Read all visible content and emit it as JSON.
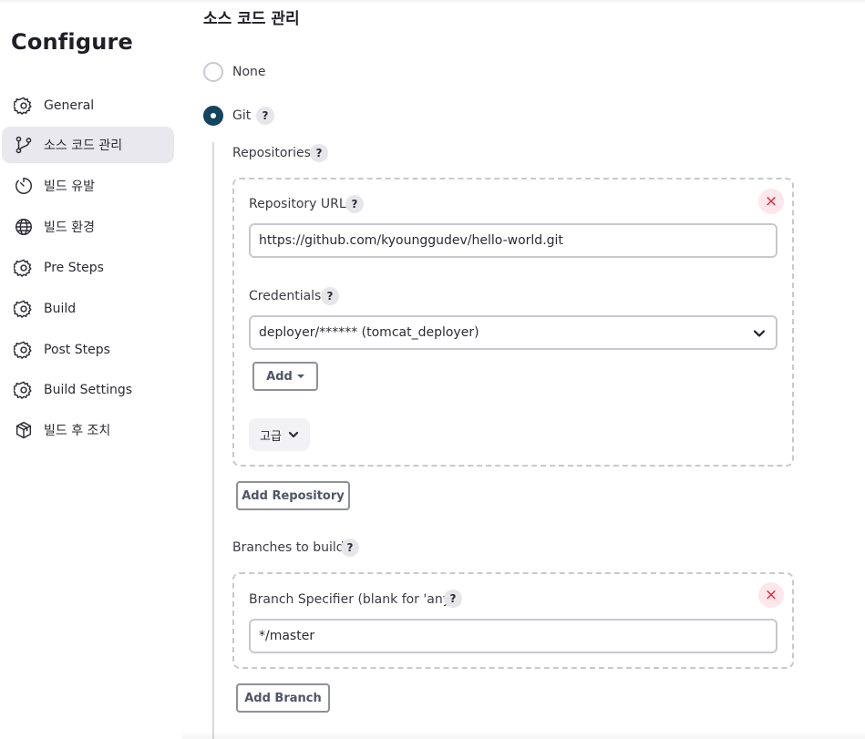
{
  "sidebar": {
    "title": "Configure",
    "items": [
      {
        "label": "General",
        "icon": "gear-icon"
      },
      {
        "label": "소스 코드 관리",
        "icon": "branch-icon",
        "active": true
      },
      {
        "label": "빌드 유발",
        "icon": "timer-icon"
      },
      {
        "label": "빌드 환경",
        "icon": "globe-icon"
      },
      {
        "label": "Pre Steps",
        "icon": "gear-icon"
      },
      {
        "label": "Build",
        "icon": "gear-icon"
      },
      {
        "label": "Post Steps",
        "icon": "gear-icon"
      },
      {
        "label": "Build Settings",
        "icon": "gear-icon"
      },
      {
        "label": "빌드 후 조치",
        "icon": "package-icon"
      }
    ]
  },
  "main": {
    "section_title": "소스 코드 관리",
    "scm_options": [
      {
        "label": "None",
        "selected": false
      },
      {
        "label": "Git",
        "selected": true
      }
    ],
    "help_glyph": "?",
    "repositories": {
      "label": "Repositories",
      "repository_url_label": "Repository URL",
      "repository_url_value": "https://github.com/kyounggudev/hello-world.git",
      "credentials_label": "Credentials",
      "credentials_value": "deployer/****** (tomcat_deployer)",
      "add_label": "Add",
      "advanced_label": "고급",
      "add_repository_label": "Add Repository"
    },
    "branches": {
      "label": "Branches to build",
      "specifier_label": "Branch Specifier (blank for 'any')",
      "specifier_value": "*/master",
      "add_branch_label": "Add Branch"
    },
    "remove_glyph": "×"
  },
  "colors": {
    "accent": "#14455f",
    "remove": "#e0243a",
    "remove_bg": "#fde7ea",
    "active_nav_bg": "#e8e8ee"
  }
}
